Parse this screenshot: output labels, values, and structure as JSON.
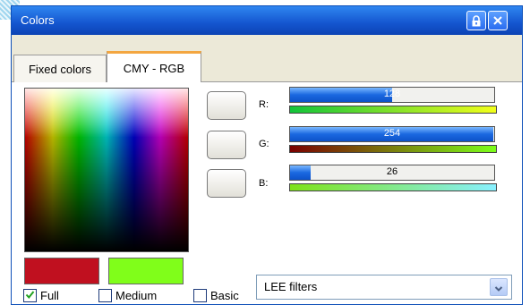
{
  "window": {
    "title": "Colors"
  },
  "tabs": [
    {
      "label": "Fixed colors",
      "active": false
    },
    {
      "label": "CMY - RGB",
      "active": true
    }
  ],
  "swatches": {
    "current": "#c0101f",
    "new": "#80fe1a"
  },
  "channels": [
    {
      "label": "R:",
      "value": "128",
      "fraction": 0.502,
      "gradient_from": "#12c43a",
      "gradient_to": "#f2ff1a"
    },
    {
      "label": "G:",
      "value": "254",
      "fraction": 0.996,
      "gradient_from": "#7a0000",
      "gradient_to": "#7cff1a"
    },
    {
      "label": "B:",
      "value": "26",
      "fraction": 0.102,
      "gradient_from": "#7ee219",
      "gradient_to": "#88f0ff"
    }
  ],
  "modes": [
    {
      "label": "Full",
      "checked": true
    },
    {
      "label": "Medium",
      "checked": false
    },
    {
      "label": "Basic",
      "checked": false
    }
  ],
  "palette_select": {
    "value": "LEE filters"
  },
  "icons": {
    "lock": "lock-icon",
    "close": "close-icon",
    "dropdown": "chevron-down-icon",
    "check": "checkmark-icon"
  }
}
